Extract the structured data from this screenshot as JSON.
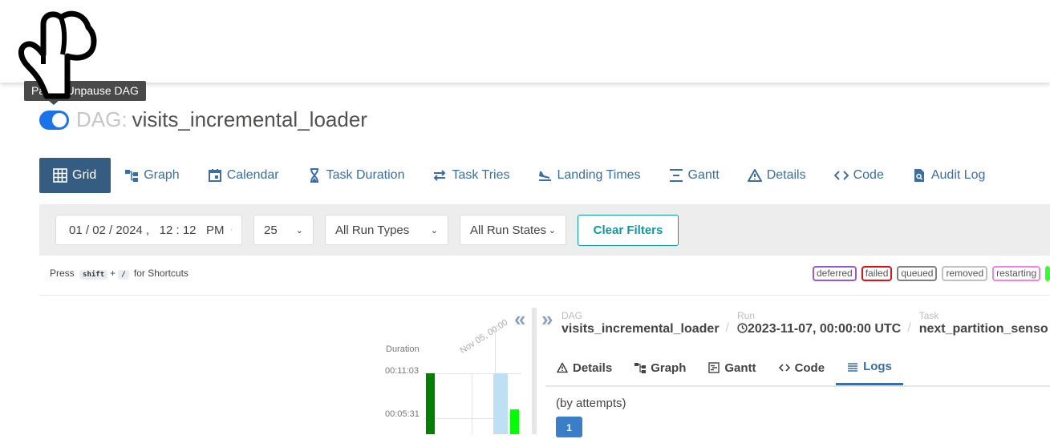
{
  "tooltip": {
    "text": "Pause/Unpause DAG"
  },
  "dag_header": {
    "prefix": "DAG:",
    "name": "visits_incremental_loader",
    "paused": false
  },
  "tabs": [
    {
      "label": "Grid",
      "icon": "grid-icon",
      "active": true
    },
    {
      "label": "Graph",
      "icon": "graph-icon"
    },
    {
      "label": "Calendar",
      "icon": "calendar-icon"
    },
    {
      "label": "Task Duration",
      "icon": "hourglass-icon"
    },
    {
      "label": "Task Tries",
      "icon": "retry-icon"
    },
    {
      "label": "Landing Times",
      "icon": "landing-icon"
    },
    {
      "label": "Gantt",
      "icon": "gantt-icon"
    },
    {
      "label": "Details",
      "icon": "warning-triangle-icon"
    },
    {
      "label": "Code",
      "icon": "code-icon"
    },
    {
      "label": "Audit Log",
      "icon": "audit-doc-icon"
    }
  ],
  "filters": {
    "date": {
      "month": "01",
      "day": "02",
      "year": "2024",
      "hour": "12",
      "minute": "12",
      "ampm": "PM"
    },
    "num_runs": "25",
    "run_type": "All Run Types",
    "run_state": "All Run States",
    "clear_label": "Clear Filters"
  },
  "shortcuts": {
    "press": "Press",
    "key1": "shift",
    "plus": "+",
    "key2": "/",
    "suffix": "for Shortcuts"
  },
  "legend": [
    {
      "label": "deferred",
      "color": "#9b59d0"
    },
    {
      "label": "failed",
      "color": "#e01010"
    },
    {
      "label": "queued",
      "color": "#808080"
    },
    {
      "label": "removed",
      "color": "#c0c0c0"
    },
    {
      "label": "restarting",
      "color": "#ee82ee"
    }
  ],
  "grid": {
    "duration_label": "Duration",
    "ticks": [
      "00:11:03",
      "00:05:31"
    ],
    "date_tick": "Nov 05, 00:00",
    "colors": {
      "success": "#008000",
      "running": "#00ff00",
      "queued_bar": "#bde0f3"
    }
  },
  "breadcrumbs": {
    "dag_label": "DAG",
    "dag_value": "visits_incremental_loader",
    "run_label": "Run",
    "run_value": "2023-11-07, 00:00:00 UTC",
    "task_label": "Task",
    "task_value": "next_partition_senso"
  },
  "detail_tabs": [
    {
      "label": "Details",
      "icon": "warning-triangle-icon"
    },
    {
      "label": "Graph",
      "icon": "graph-icon"
    },
    {
      "label": "Gantt",
      "icon": "gantt-icon"
    },
    {
      "label": "Code",
      "icon": "code-icon"
    },
    {
      "label": "Logs",
      "icon": "list-icon",
      "active": true
    }
  ],
  "logs": {
    "by_attempts": "(by attempts)",
    "attempt": "1"
  }
}
